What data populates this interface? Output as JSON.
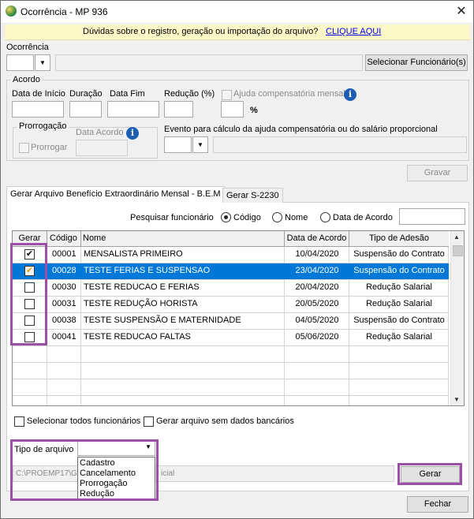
{
  "window": {
    "title": "Ocorrência - MP 936"
  },
  "infobar": {
    "text": "Dúvidas sobre o registro, geração ou importação do arquivo?",
    "link": "CLIQUE AQUI"
  },
  "ocorrencia": {
    "label": "Ocorrência",
    "select_employee_button": "Selecionar Funcionário(s)"
  },
  "acordo": {
    "title": "Acordo",
    "labels": {
      "data_inicio": "Data de Início",
      "duracao": "Duração",
      "data_fim": "Data Fim",
      "reducao": "Redução (%)",
      "ajuda": "Ajuda compensatória mensal",
      "percent": "%"
    },
    "prorrogacao": {
      "title": "Prorrogação",
      "prorrogar": "Prorrogar",
      "data_acordo": "Data Acordo"
    },
    "evento_label": "Evento para cálculo da ajuda compensatória ou do salário proporcional",
    "gravar_button": "Gravar"
  },
  "tabs": [
    {
      "label": "Gerar Arquivo Benefício Extraordinário Mensal - B.E.M",
      "active": true
    },
    {
      "label": "Gerar S-2230",
      "active": false
    }
  ],
  "search": {
    "label": "Pesquisar funcionário",
    "options": [
      "Código",
      "Nome",
      "Data de Acordo"
    ],
    "selected": "Código"
  },
  "table": {
    "columns": [
      "Gerar",
      "Código",
      "Nome",
      "Data de Acordo",
      "Tipo de Adesão"
    ],
    "rows": [
      {
        "checked": true,
        "codigo": "00001",
        "nome": "MENSALISTA PRIMEIRO",
        "data": "10/04/2020",
        "tipo": "Suspensão do Contrato",
        "selected": false
      },
      {
        "checked": true,
        "codigo": "00028",
        "nome": "TESTE FERIAS E SUSPENSAO",
        "data": "23/04/2020",
        "tipo": "Suspensão do Contrato",
        "selected": true
      },
      {
        "checked": false,
        "codigo": "00030",
        "nome": "TESTE REDUCAO E FERIAS",
        "data": "20/04/2020",
        "tipo": "Redução Salarial",
        "selected": false
      },
      {
        "checked": false,
        "codigo": "00031",
        "nome": "TESTE REDUÇÃO HORISTA",
        "data": "20/05/2020",
        "tipo": "Redução Salarial",
        "selected": false
      },
      {
        "checked": false,
        "codigo": "00038",
        "nome": "TESTE SUSPENSÃO E MATERNIDADE",
        "data": "04/05/2020",
        "tipo": "Suspensão do Contrato",
        "selected": false
      },
      {
        "checked": false,
        "codigo": "00041",
        "nome": "TESTE REDUCAO FALTAS",
        "data": "05/06/2020",
        "tipo": "Redução Salarial",
        "selected": false
      }
    ]
  },
  "options": {
    "select_all": "Selecionar todos funcionários",
    "no_bank_data": "Gerar arquivo sem dados bancários"
  },
  "file": {
    "tipo_label": "Tipo de arquivo",
    "dropdown_items": [
      "Cadastro",
      "Cancelamento",
      "Prorrogação",
      "Redução"
    ],
    "path_left": "C:\\PROEMP17\\G",
    "path_right": "icial",
    "gerar_button": "Gerar"
  },
  "footer": {
    "fechar_button": "Fechar"
  },
  "colors": {
    "selection": "#0078d7",
    "highlight": "#9b4fa6",
    "infobar_bg": "#fdf8c7",
    "link": "#0000ee"
  }
}
